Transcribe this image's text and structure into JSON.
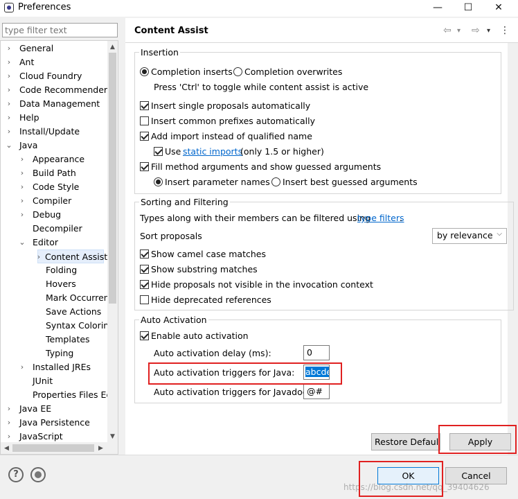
{
  "window": {
    "title": "Preferences",
    "minimize": "—",
    "maximize": "☐",
    "close": "✕"
  },
  "filter": {
    "placeholder": "type filter text"
  },
  "tree": [
    {
      "label": "General",
      "arrow": "›",
      "level": 0
    },
    {
      "label": "Ant",
      "arrow": "›",
      "level": 0
    },
    {
      "label": "Cloud Foundry",
      "arrow": "›",
      "level": 0
    },
    {
      "label": "Code Recommenders",
      "arrow": "›",
      "level": 0
    },
    {
      "label": "Data Management",
      "arrow": "›",
      "level": 0
    },
    {
      "label": "Help",
      "arrow": "›",
      "level": 0
    },
    {
      "label": "Install/Update",
      "arrow": "›",
      "level": 0
    },
    {
      "label": "Java",
      "arrow": "⌄",
      "level": 0
    },
    {
      "label": "Appearance",
      "arrow": "›",
      "level": 1
    },
    {
      "label": "Build Path",
      "arrow": "›",
      "level": 1
    },
    {
      "label": "Code Style",
      "arrow": "›",
      "level": 1
    },
    {
      "label": "Compiler",
      "arrow": "›",
      "level": 1
    },
    {
      "label": "Debug",
      "arrow": "›",
      "level": 1
    },
    {
      "label": "Decompiler",
      "arrow": "",
      "level": 1
    },
    {
      "label": "Editor",
      "arrow": "⌄",
      "level": 1
    },
    {
      "label": "Content Assist",
      "arrow": "›",
      "level": 2,
      "selected": true
    },
    {
      "label": "Folding",
      "arrow": "",
      "level": 2
    },
    {
      "label": "Hovers",
      "arrow": "",
      "level": 2
    },
    {
      "label": "Mark Occurren",
      "arrow": "",
      "level": 2
    },
    {
      "label": "Save Actions",
      "arrow": "",
      "level": 2
    },
    {
      "label": "Syntax Coloring",
      "arrow": "",
      "level": 2
    },
    {
      "label": "Templates",
      "arrow": "",
      "level": 2
    },
    {
      "label": "Typing",
      "arrow": "",
      "level": 2
    },
    {
      "label": "Installed JREs",
      "arrow": "›",
      "level": 1
    },
    {
      "label": "JUnit",
      "arrow": "",
      "level": 1
    },
    {
      "label": "Properties Files Ed",
      "arrow": "",
      "level": 1
    },
    {
      "label": "Java EE",
      "arrow": "›",
      "level": 0
    },
    {
      "label": "Java Persistence",
      "arrow": "›",
      "level": 0
    },
    {
      "label": "JavaScript",
      "arrow": "›",
      "level": 0
    }
  ],
  "page": {
    "title": "Content Assist",
    "nav": {
      "back": "⇦",
      "back_menu": "▾",
      "forward": "⇨",
      "forward_menu": "▾",
      "menu": "⋮"
    }
  },
  "insertion": {
    "legend": "Insertion",
    "radio_inserts": "Completion inserts",
    "radio_overwrites": "Completion overwrites",
    "toggle_hint": "Press 'Ctrl' to toggle while content assist is active",
    "single_proposals": "Insert single proposals automatically",
    "common_prefixes": "Insert common prefixes automatically",
    "add_import": "Add import instead of qualified name",
    "use": "Use",
    "static_imports": "static imports",
    "only_15": "(only 1.5 or higher)",
    "fill_method": "Fill method arguments and show guessed arguments",
    "param_names": "Insert parameter names",
    "best_guessed": "Insert best guessed arguments"
  },
  "sorting": {
    "legend": "Sorting and Filtering",
    "types_along": "Types along with their members can be filtered using",
    "type_filters": "type filters",
    "period": ".",
    "sort_label": "Sort proposals",
    "sort_value": "by relevance",
    "camel_case": "Show camel case matches",
    "substring": "Show substring matches",
    "hide_not_visible": "Hide proposals not visible in the invocation context",
    "hide_deprecated": "Hide deprecated references"
  },
  "auto": {
    "legend": "Auto Activation",
    "enable": "Enable auto activation",
    "delay_label": "Auto activation delay (ms):",
    "delay_value": "0",
    "java_label": "Auto activation triggers for Java:",
    "java_value": "abcde",
    "javadoc_label": "Auto activation triggers for Javadoc:",
    "javadoc_value": "@#"
  },
  "buttons": {
    "restore": "Restore Defaults",
    "apply": "Apply",
    "ok": "OK",
    "cancel": "Cancel",
    "help": "?"
  },
  "watermark": "https://blog.csdn.net/qq_39404626",
  "colors": {
    "highlight": "#e02020",
    "selection": "#0078d7",
    "link": "#0066cc"
  }
}
